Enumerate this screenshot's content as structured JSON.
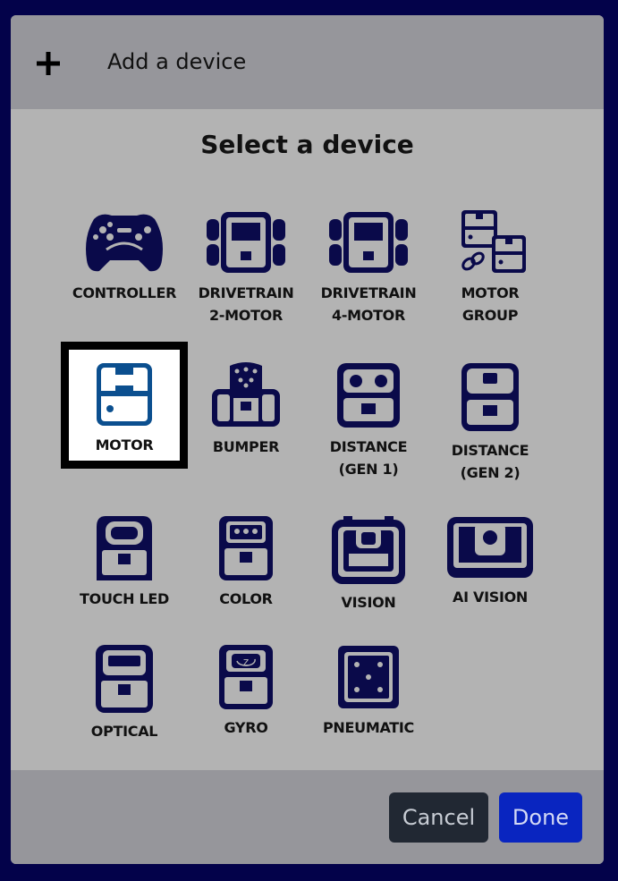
{
  "header": {
    "title": "Add a device"
  },
  "section_title": "Select a device",
  "devices": [
    {
      "label": "CONTROLLER"
    },
    {
      "label": "DRIVETRAIN\n2-MOTOR"
    },
    {
      "label": "DRIVETRAIN\n4-MOTOR"
    },
    {
      "label": "MOTOR\nGROUP"
    },
    {
      "label": "MOTOR",
      "selected": true
    },
    {
      "label": "BUMPER"
    },
    {
      "label": "DISTANCE\n(GEN 1)"
    },
    {
      "label": "DISTANCE\n(GEN 2)"
    },
    {
      "label": "TOUCH LED"
    },
    {
      "label": "COLOR"
    },
    {
      "label": "VISION"
    },
    {
      "label": "AI VISION"
    },
    {
      "label": "OPTICAL"
    },
    {
      "label": "GYRO"
    },
    {
      "label": "PNEUMATIC"
    }
  ],
  "footer": {
    "cancel_label": "Cancel",
    "done_label": "Done"
  },
  "colors": {
    "icon": "#0a0a4a",
    "selected_icon": "#0b4f8f",
    "done": "#0925c0",
    "cancel": "#212833"
  }
}
